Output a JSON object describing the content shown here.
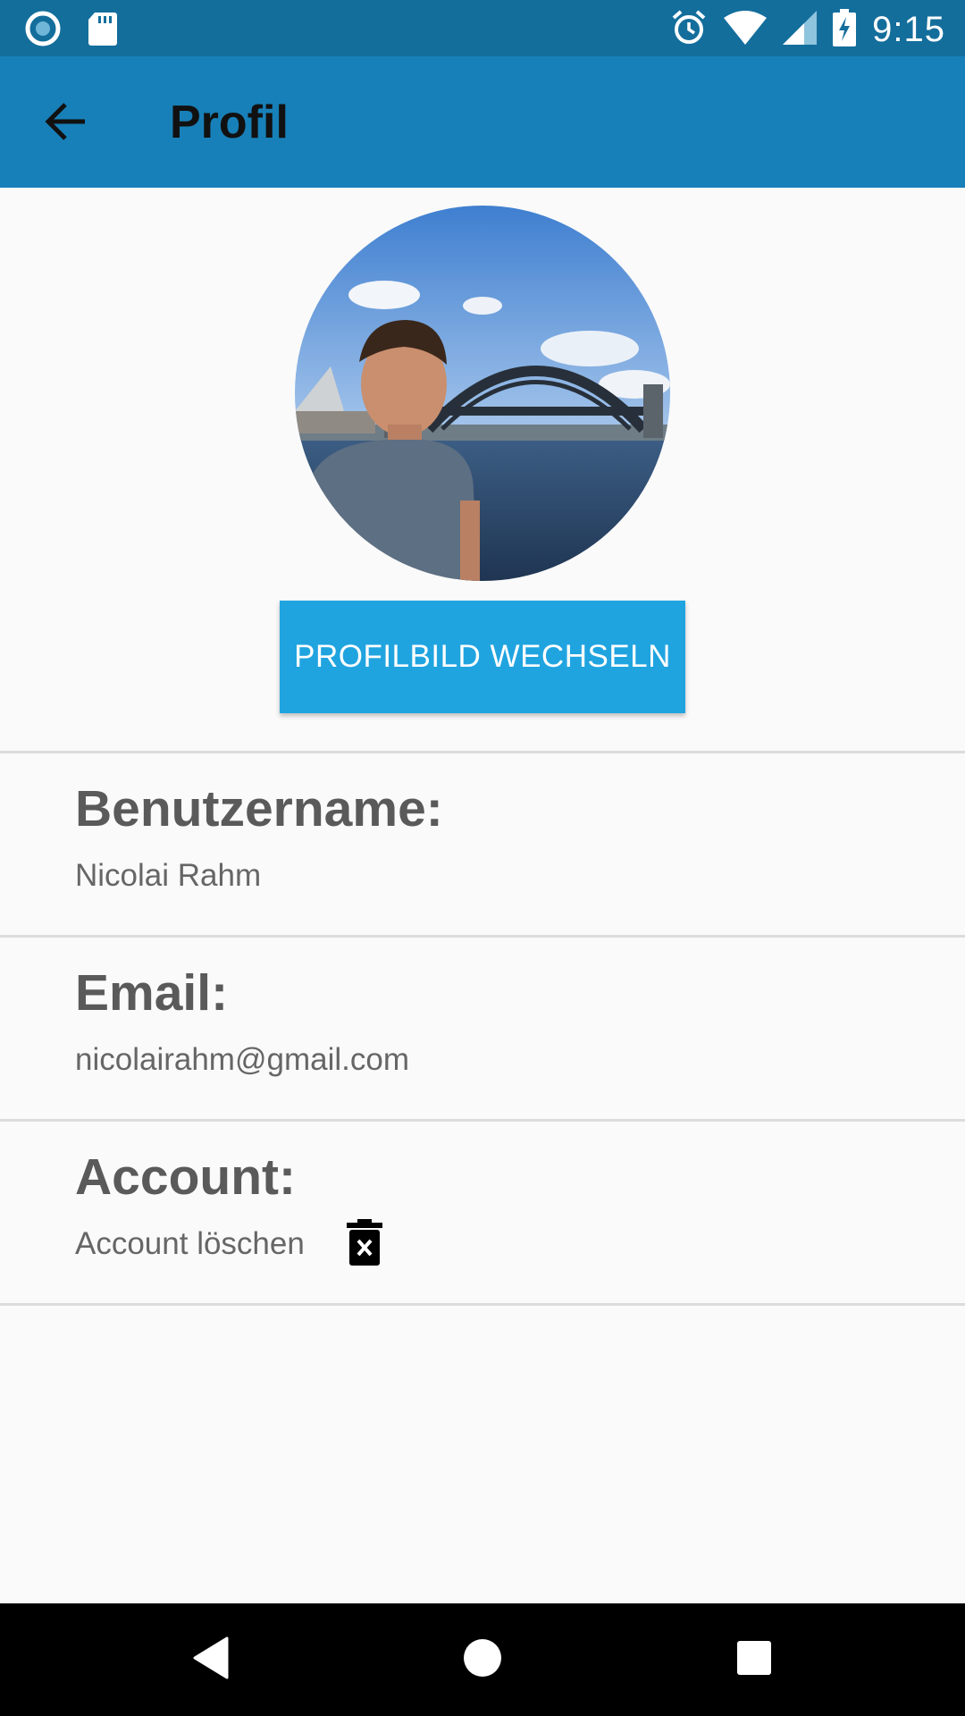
{
  "status_bar": {
    "time": "9:15",
    "icons": [
      "record-icon",
      "sd-card-icon",
      "alarm-icon",
      "wifi-icon",
      "signal-icon",
      "battery-charging-icon"
    ]
  },
  "app_bar": {
    "title": "Profil",
    "back_icon": "arrow-left-icon",
    "color": "#1880b8"
  },
  "profile": {
    "avatar_icon": "profile-photo",
    "change_button_label": "PROFILBILD WECHSELN",
    "button_color": "#20a4e0"
  },
  "sections": {
    "username": {
      "label": "Benutzername:",
      "value": "Nicolai Rahm"
    },
    "email": {
      "label": "Email:",
      "value": "nicolairahm@gmail.com"
    },
    "account": {
      "label": "Account:",
      "value": "Account löschen",
      "icon": "trash-delete-icon"
    }
  },
  "nav_bar": {
    "icons": [
      "back-triangle-icon",
      "home-circle-icon",
      "recents-square-icon"
    ]
  }
}
